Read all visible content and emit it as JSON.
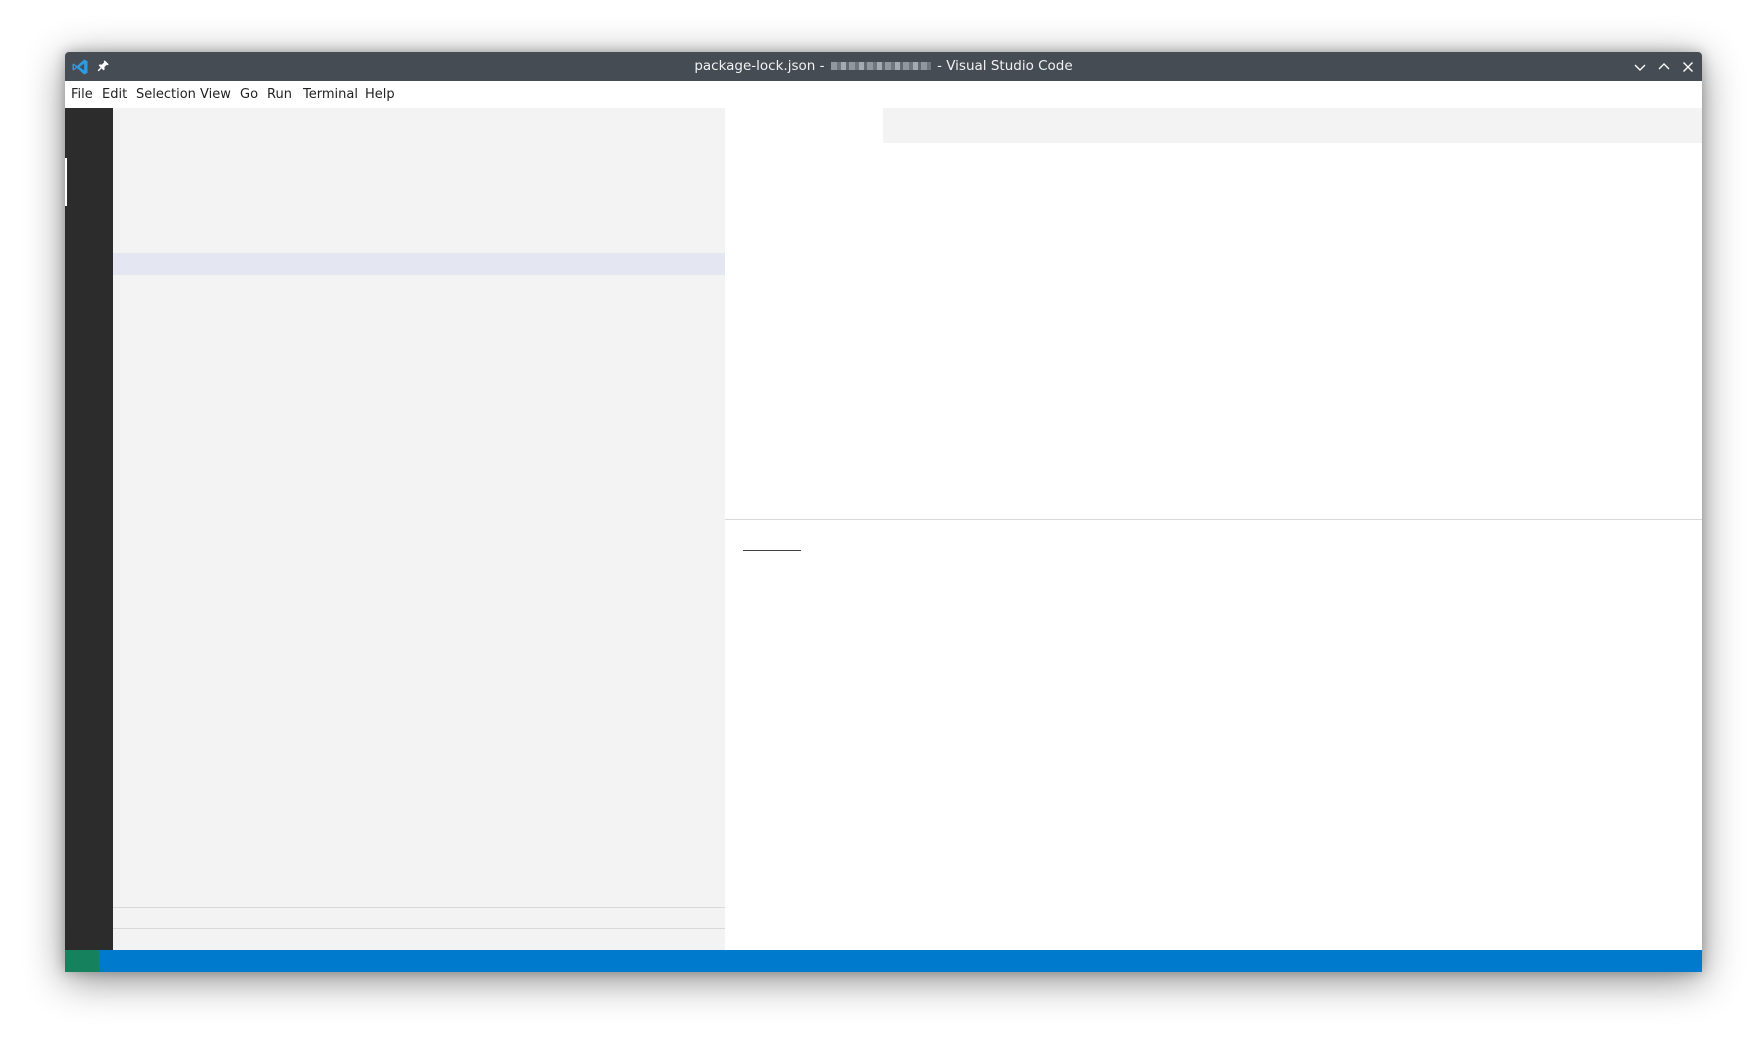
{
  "window": {
    "title_prefix": "package-lock.json - ",
    "title_suffix": " - Visual Studio Code"
  },
  "icons": {
    "app_logo": "vscode-logo-icon",
    "pin": "pin-icon",
    "minimize": "chevron-down-icon",
    "maximize": "chevron-up-icon",
    "close": "close-icon"
  },
  "menu": {
    "items": [
      "File",
      "Edit",
      "Selection",
      "View",
      "Go",
      "Run",
      "Terminal",
      "Help"
    ]
  },
  "colors": {
    "titlebar": "#454c54",
    "activitybar": "#2c2c2c",
    "sidebar": "#f3f3f3",
    "statusbar": "#007acc",
    "status_remote": "#16825d"
  }
}
